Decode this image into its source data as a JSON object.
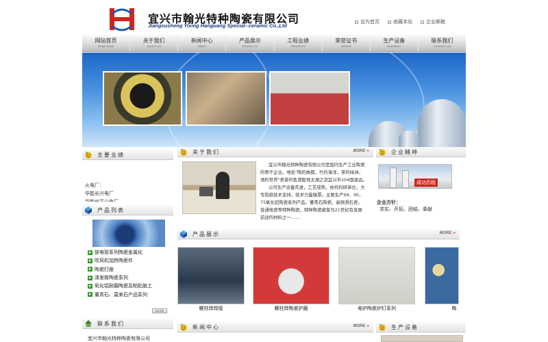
{
  "header": {
    "title_cn": "宜兴市翰光特种陶瓷有限公司",
    "title_en": "Jiangsusheng Yixing Hanguang Special--ceramic Co.,Ltd",
    "links": [
      "设为首页",
      "收藏本站",
      "企业邮箱"
    ]
  },
  "nav": [
    {
      "cn": "网站首页",
      "en": "HOME PAGE"
    },
    {
      "cn": "关于我们",
      "en": "ABOUT US"
    },
    {
      "cn": "新闻中心",
      "en": "NEWS"
    },
    {
      "cn": "产品展示",
      "en": "PRODUCTS"
    },
    {
      "cn": "工程业绩",
      "en": "PROJECTS"
    },
    {
      "cn": "荣誉证书",
      "en": "HONOR"
    },
    {
      "cn": "生产设备",
      "en": "OUIPMENT"
    },
    {
      "cn": "联系我们",
      "en": "CONTACT US"
    }
  ],
  "main_business": {
    "title": "主要业绩",
    "lines": [
      "火电厂：",
      "华能长兴电厂",
      "华能州平山电厂"
    ]
  },
  "product_list": {
    "title": "产品列表",
    "items": [
      "放电管系列陶瓷金属化",
      "吹风机加热陶瓷件",
      "陶瓷灯座",
      "漆发板陶瓷系列",
      "氧化铝耐磨陶瓷及粘贴施工",
      "董青石、莫来石产品系列"
    ],
    "more": "MORE"
  },
  "contact": {
    "title": "联系我们",
    "line": "宜兴市翰光特种陶瓷有限公司"
  },
  "about": {
    "title": "关于我们",
    "more": "MORE",
    "text": [
      "宜兴市翰光特种陶瓷有限公司是国内生产工业陶瓷",
      "的骨干企业。地处\"陶的故都，竹的海洋，茶的绿洲，",
      "洞的世界\"美誉的鱼游胜地太湖之滨宜兴市104国道边。",
      "公司生产设备先进，工艺成熟，依托科研单位，大",
      "专院校技术支持，技术力量雄厚。主要生产99、95、",
      "75氧化铝陶瓷系列产品，董青石陶瓷、高频滑石瓷，",
      "普通电瓷等特种陶瓷。特种陶瓷被誉为21世纪有发展",
      "前途的材料之一……"
    ]
  },
  "spirit": {
    "title": "企业精神",
    "img_label": "成功历程",
    "policy_label": "企业方针：",
    "policy": "求实、开拓、团结、奉献"
  },
  "products_show": {
    "title": "产品展示",
    "more": "MORE",
    "items": [
      "螺柱焊焊接",
      "螺柱焊陶瓷护圈",
      "电炉陶瓷炉钉系列",
      "陶"
    ]
  },
  "news": {
    "title": "新闻中心",
    "more": "MORE"
  },
  "equipment": {
    "title": "生产设备"
  },
  "colors": {
    "accent_red": "#d0241c",
    "nav_gray": "#d9d9d9",
    "arrow_green": "#3a9a2e",
    "banner_blue": "#2a74d0"
  }
}
